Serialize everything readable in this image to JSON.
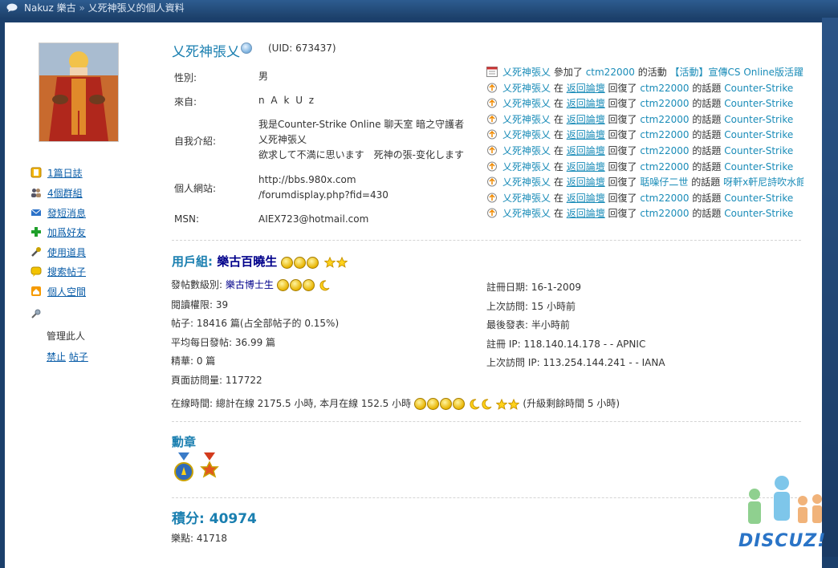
{
  "breadcrumb": {
    "site": "Nakuz 樂古",
    "separator": "»",
    "page": "乂死神張乂的個人資料"
  },
  "profile": {
    "username": "乂死神張乂",
    "uid": "(UID: 673437)",
    "fields": [
      {
        "label": "性別:",
        "value": [
          "男"
        ]
      },
      {
        "label": "來自:",
        "value": [
          "n A k U z"
        ]
      },
      {
        "label": "自我介紹:",
        "value": [
          "我是Counter-Strike Online 聊天室 暗之守護者",
          "乂死神張乂",
          "欲求して不満に思います　死神の張-变化します"
        ]
      },
      {
        "label": "個人網站:",
        "value": [
          "http://bbs.980x.com",
          "/forumdisplay.php?fid=430"
        ]
      },
      {
        "label": "MSN:",
        "value": [
          "AIEX723@hotmail.com"
        ]
      }
    ]
  },
  "sidebar": {
    "items": [
      {
        "label": "1篇日誌",
        "icon": "blog-icon"
      },
      {
        "label": "4個群組",
        "icon": "group-icon"
      },
      {
        "label": "發短消息",
        "icon": "mail-icon"
      },
      {
        "label": "加爲好友",
        "icon": "add-friend-icon"
      },
      {
        "label": "使用道具",
        "icon": "tool-icon"
      },
      {
        "label": "搜索帖子",
        "icon": "search-posts-icon"
      },
      {
        "label": "個人空間",
        "icon": "home-icon"
      }
    ],
    "manage_label": "管理此人",
    "ban_label": "禁止",
    "posts_label": "帖子"
  },
  "feed": [
    {
      "type": "event",
      "user": "乂死神張乂",
      "verb": "參加了",
      "target": "ctm22000",
      "mid": "的活動",
      "topic": "【活動】宣傳CS Online版活躍"
    },
    {
      "type": "reply",
      "user": "乂死神張乂",
      "at": "在",
      "forum": "返回論壇",
      "verb": "回復了",
      "target": "ctm22000",
      "mid": "的話題",
      "topic": "Counter-Strike"
    },
    {
      "type": "reply",
      "user": "乂死神張乂",
      "at": "在",
      "forum": "返回論壇",
      "verb": "回復了",
      "target": "ctm22000",
      "mid": "的話題",
      "topic": "Counter-Strike"
    },
    {
      "type": "reply",
      "user": "乂死神張乂",
      "at": "在",
      "forum": "返回論壇",
      "verb": "回復了",
      "target": "ctm22000",
      "mid": "的話題",
      "topic": "Counter-Strike"
    },
    {
      "type": "reply",
      "user": "乂死神張乂",
      "at": "在",
      "forum": "返回論壇",
      "verb": "回復了",
      "target": "ctm22000",
      "mid": "的話題",
      "topic": "Counter-Strike"
    },
    {
      "type": "reply",
      "user": "乂死神張乂",
      "at": "在",
      "forum": "返回論壇",
      "verb": "回復了",
      "target": "ctm22000",
      "mid": "的話題",
      "topic": "Counter-Strike"
    },
    {
      "type": "reply",
      "user": "乂死神張乂",
      "at": "在",
      "forum": "返回論壇",
      "verb": "回復了",
      "target": "ctm22000",
      "mid": "的話題",
      "topic": "Counter-Strike"
    },
    {
      "type": "reply",
      "user": "乂死神張乂",
      "at": "在",
      "forum": "返回論壇",
      "verb": "回復了",
      "target": "聒噪仔二世",
      "mid": "的話題",
      "topic": "呀軒x軒尼詩吹水館"
    },
    {
      "type": "reply",
      "user": "乂死神張乂",
      "at": "在",
      "forum": "返回論壇",
      "verb": "回復了",
      "target": "ctm22000",
      "mid": "的話題",
      "topic": "Counter-Strike"
    },
    {
      "type": "reply",
      "user": "乂死神張乂",
      "at": "在",
      "forum": "返回論壇",
      "verb": "回復了",
      "target": "ctm22000",
      "mid": "的話題",
      "topic": "Counter-Strike"
    }
  ],
  "group": {
    "prefix": "用戶組:",
    "name": "樂古百曉生"
  },
  "stats_left": {
    "post_level_label": "發帖數級別:",
    "post_level_name": "樂古博士生",
    "read_perm": "閱讀權限: 39",
    "posts": "帖子: 18416 篇(占全部帖子的 0.15%)",
    "avg_posts": "平均每日發帖: 36.99 篇",
    "digest": "精華: 0 篇",
    "page_views": "頁面訪問量: 117722"
  },
  "stats_right": {
    "reg_date": "註冊日期: 16-1-2009",
    "last_visit": "上次訪問: 15 小時前",
    "last_post": "最後發表: 半小時前",
    "reg_ip": "註冊 IP: 118.140.14.178 - - APNIC",
    "last_ip": "上次訪問 IP: 113.254.144.241 - - IANA"
  },
  "online_time": {
    "text": "在線時間: 總計在線 2175.5 小時, 本月在線 152.5 小時",
    "upgrade": "(升級剩餘時間 5 小時)"
  },
  "medals_title": "勳章",
  "credits": {
    "label": "積分:",
    "value": "40974"
  },
  "lepoints": "樂點: 41718",
  "logo_text": "DISCUZ!",
  "colors": {
    "link": "#0a5da8",
    "accent": "#1a7fb0",
    "group_name": "#00008b",
    "bg": "#1b3f6b"
  }
}
